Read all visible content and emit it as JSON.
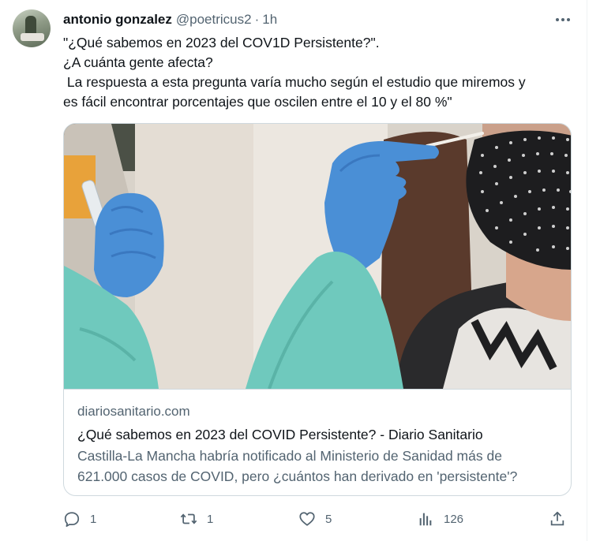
{
  "tweet": {
    "author_name": "antonio gonzalez",
    "author_handle": "@poetricus2",
    "separator": "·",
    "time": "1h",
    "text_lines": [
      "\"¿Qué sabemos en 2023 del COV1D Persistente?\".",
      "¿A cuánta gente afecta?",
      " La respuesta a esta pregunta varía mucho según el estudio que miremos y",
      "es fácil encontrar porcentajes que oscilen entre el 10 y el 80 %\""
    ]
  },
  "card": {
    "domain": "diariosanitario.com",
    "title": "¿Qué sabemos en 2023 del COVID Persistente? - Diario Sanitario",
    "description_lines": [
      "Castilla-La Mancha habría notificado al Ministerio de Sanidad más de",
      "621.000 casos de COVID, pero ¿cuántos han derivado en 'persistente'?"
    ]
  },
  "actions": {
    "replies": "1",
    "retweets": "1",
    "likes": "5",
    "views": "126"
  },
  "icons": {
    "more": "more-dots-icon",
    "reply": "reply-icon",
    "retweet": "retweet-icon",
    "like": "heart-icon",
    "views": "views-icon",
    "share": "share-icon"
  },
  "colors": {
    "text_primary": "#0f1419",
    "text_secondary": "#536471",
    "border": "#cfd9de"
  }
}
